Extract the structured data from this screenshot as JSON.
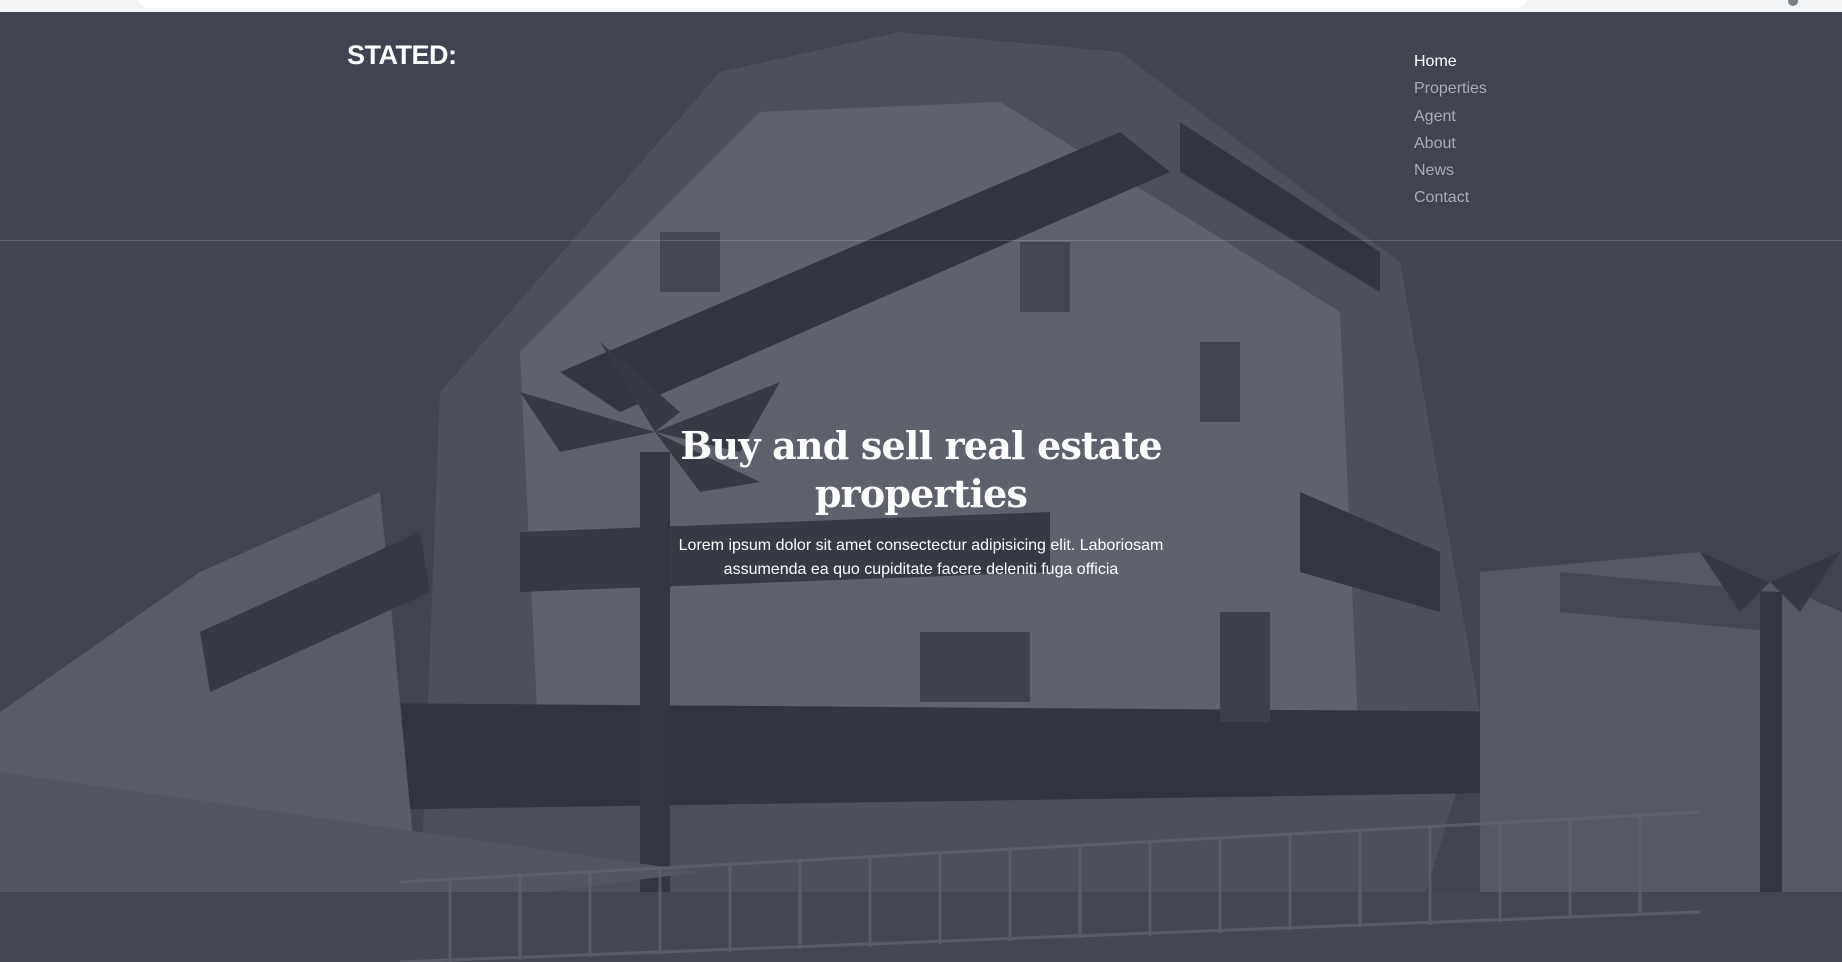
{
  "site": {
    "logo": "STATED:"
  },
  "nav": {
    "items": [
      {
        "label": "Home"
      },
      {
        "label": "Properties"
      },
      {
        "label": "Agent"
      },
      {
        "label": "About"
      },
      {
        "label": "News"
      },
      {
        "label": "Contact"
      }
    ],
    "active_index": 0
  },
  "hero": {
    "headline": "Buy and sell real estate properties",
    "subtext": "Lorem ipsum dolor sit amet consectectur adipisicing elit. Laboriosam assumenda ea quo cupiditate facere deleniti fuga officia"
  },
  "colors": {
    "overlay": "#343945",
    "text": "#ffffff",
    "nav_inactive": "#a9adb5"
  }
}
